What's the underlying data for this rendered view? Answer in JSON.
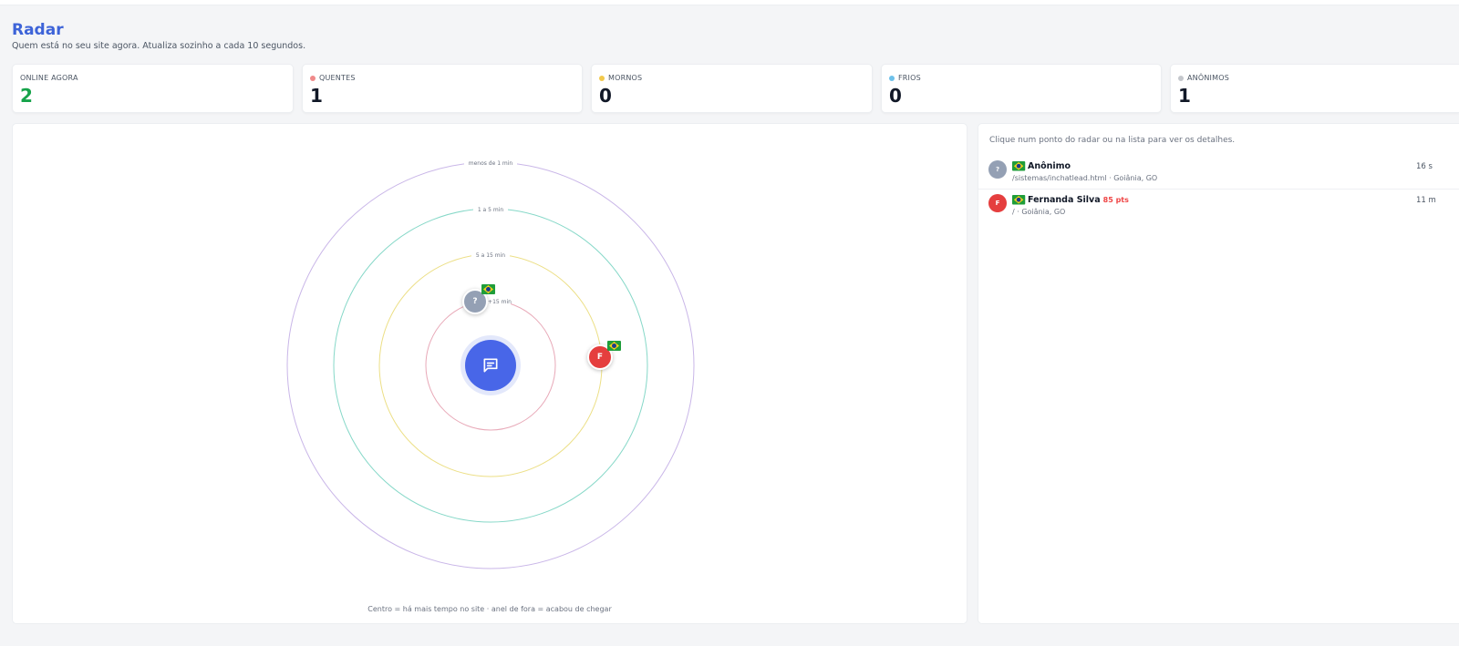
{
  "header": {
    "title": "Radar",
    "subtitle": "Quem está no seu site agora. Atualiza sozinho a cada 10 segundos."
  },
  "stats": [
    {
      "label": "ONLINE AGORA",
      "value": "2",
      "dot_color": null,
      "value_color": "#16a34a"
    },
    {
      "label": "QUENTES",
      "value": "1",
      "dot_color": "#f08a8a"
    },
    {
      "label": "MORNOS",
      "value": "0",
      "dot_color": "#f2c94c"
    },
    {
      "label": "FRIOS",
      "value": "0",
      "dot_color": "#6ec1ea"
    },
    {
      "label": "ANÔNIMOS",
      "value": "1",
      "dot_color": "#c4c7cc"
    }
  ],
  "radar": {
    "rings": [
      {
        "label": "menos de 1 min",
        "color": "#c9b6e8"
      },
      {
        "label": "1 a 5 min",
        "color": "#86d8c8"
      },
      {
        "label": "5 a 15 min",
        "color": "#ecdf86"
      },
      {
        "label": "+15 min",
        "color": "#e8a9b8"
      }
    ],
    "center_icon": "chat-icon",
    "center_color": "#4866e8",
    "footer": "Centro = há mais tempo no site · anel de fora = acabou de chegar",
    "visitors": [
      {
        "initial": "?",
        "color": "#94a0b4",
        "flag": "brazil-flag-icon"
      },
      {
        "initial": "F",
        "color": "#e53e3e",
        "flag": "brazil-flag-icon"
      }
    ]
  },
  "list": {
    "hint": "Clique num ponto do radar ou na lista para ver os detalhes.",
    "items": [
      {
        "initial": "?",
        "avatar_color": "#94a0b4",
        "name": "Anônimo",
        "score": "",
        "subtitle": "/sistemas/inchatlead.html · Goiânia, GO",
        "time": "16 s",
        "flag": "brazil-flag-icon"
      },
      {
        "initial": "F",
        "avatar_color": "#e53e3e",
        "name": "Fernanda Silva",
        "score": "85 pts",
        "subtitle": "/ · Goiânia, GO",
        "time": "11 m",
        "flag": "brazil-flag-icon"
      }
    ]
  }
}
